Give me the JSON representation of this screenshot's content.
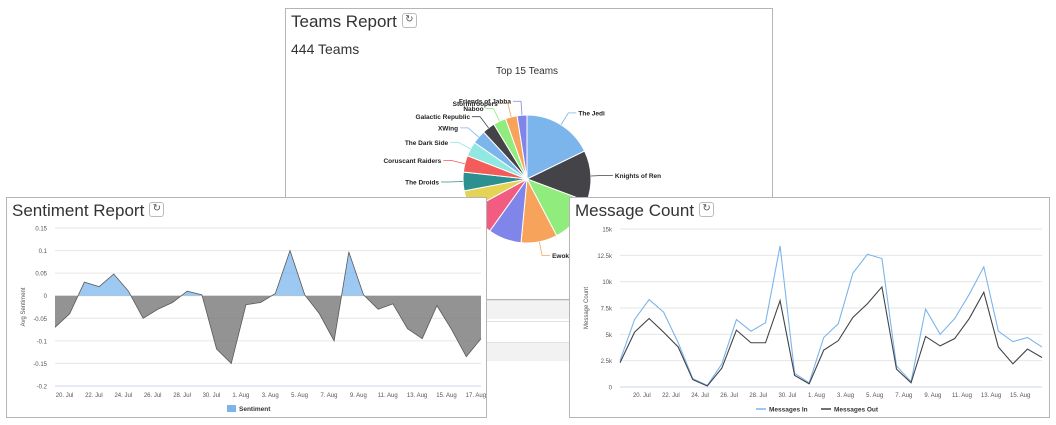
{
  "teams_panel": {
    "title": "Teams Report",
    "refresh_icon": "refresh-icon",
    "count_text": "444 Teams"
  },
  "sentiment_panel": {
    "title": "Sentiment Report",
    "refresh_icon": "refresh-icon"
  },
  "messages_panel": {
    "title": "Message Count",
    "refresh_icon": "refresh-icon"
  },
  "chart_data": [
    {
      "id": "top-teams",
      "type": "pie",
      "title": "Top 15 Teams",
      "labels": [
        "The Jedi",
        "Knights of Ren",
        "",
        "Ewoks",
        "",
        "",
        "",
        "The Droids",
        "Coruscant Raiders",
        "The Dark Side",
        "XWing",
        "Galactic Republic",
        "Naboo",
        "Stormtroopers",
        "Friends of Jabba"
      ],
      "visible_partial_labels": [
        "rs"
      ],
      "values": [
        72,
        52,
        47,
        37,
        34,
        29,
        20,
        19,
        17,
        15,
        14,
        13,
        13,
        12,
        10
      ],
      "colors": [
        "#7cb5ec",
        "#434348",
        "#90ed7d",
        "#f7a35c",
        "#8085e9",
        "#f15c80",
        "#e4d354",
        "#2b908f",
        "#f45b5b",
        "#91e8e1",
        "#7cb5ec",
        "#434348",
        "#90ed7d",
        "#f7a35c",
        "#8085e9"
      ]
    },
    {
      "id": "sentiment",
      "type": "area",
      "title": "Sentiment Report",
      "xlabel": "",
      "ylabel": "Avg Sentiment",
      "ylim": [
        -0.2,
        0.15
      ],
      "yticks": [
        0.15,
        0.1,
        0.05,
        0,
        -0.05,
        -0.1,
        -0.15,
        -0.2
      ],
      "ytick_labels": [
        "0.15",
        "0.1",
        "0.05",
        "0",
        "-0.05",
        "-0.1",
        "-0.15",
        "-0.2"
      ],
      "xticks": [
        2,
        4,
        6,
        8,
        10,
        12,
        14,
        16,
        18,
        20,
        22,
        24,
        26,
        28
      ],
      "xtick_labels": [
        "20. Jul",
        "22. Jul",
        "24. Jul",
        "26. Jul",
        "28. Jul",
        "30. Jul",
        "1. Aug",
        "3. Aug",
        "5. Aug",
        "7. Aug",
        "9. Aug",
        "11. Aug",
        "13. Aug",
        "15. Aug",
        "17. Aug"
      ],
      "x_range": [
        0.8,
        29.4
      ],
      "x": [
        1,
        2,
        3,
        4,
        5,
        6,
        7,
        8,
        9,
        10,
        11,
        12,
        13,
        14,
        15,
        16,
        17,
        18,
        19,
        20,
        21,
        22,
        23,
        24,
        25,
        26,
        27,
        28,
        29
      ],
      "series": [
        {
          "name": "Sentiment",
          "values": [
            -0.07,
            -0.04,
            0.03,
            0.02,
            0.048,
            0.01,
            -0.05,
            -0.03,
            -0.015,
            0.01,
            0.002,
            -0.118,
            -0.15,
            -0.02,
            -0.015,
            0.005,
            0.1,
            0.002,
            -0.04,
            -0.1,
            0.097,
            0.002,
            -0.03,
            -0.018,
            -0.073,
            -0.095,
            -0.022,
            -0.075,
            -0.135,
            -0.095
          ]
        }
      ],
      "pos_color": "#7cb5ec",
      "neg_color": "#808080",
      "legend": "bottom-center"
    },
    {
      "id": "message-count",
      "type": "line",
      "title": "Message Count",
      "xlabel": "",
      "ylabel": "Message Count",
      "ylim": [
        0,
        15000
      ],
      "yticks": [
        0,
        2500,
        5000,
        7500,
        10000,
        12500,
        15000
      ],
      "ytick_labels": [
        "0",
        "2.5k",
        "5k",
        "7.5k",
        "10k",
        "12.5k",
        "15k"
      ],
      "xtick_labels": [
        "20. Jul",
        "22. Jul",
        "24. Jul",
        "26. Jul",
        "28. Jul",
        "30. Jul",
        "1. Aug",
        "3. Aug",
        "5. Aug",
        "7. Aug",
        "9. Aug",
        "11. Aug",
        "13. Aug",
        "15. Aug"
      ],
      "series": [
        {
          "name": "Messages In",
          "color": "#7cb5ec",
          "values": [
            2500,
            6400,
            8300,
            7100,
            4200,
            800,
            150,
            2200,
            6400,
            5300,
            6100,
            13400,
            1300,
            400,
            4700,
            6000,
            10800,
            12600,
            12200,
            2000,
            500,
            7400,
            5000,
            6500,
            8800,
            11400,
            5300,
            4300,
            4700,
            3800
          ]
        },
        {
          "name": "Messages Out",
          "color": "#434348",
          "values": [
            2300,
            5200,
            6500,
            5200,
            3800,
            700,
            100,
            1800,
            5400,
            4200,
            4200,
            8200,
            1100,
            300,
            3500,
            4400,
            6600,
            7900,
            9500,
            1700,
            400,
            4800,
            3900,
            4600,
            6500,
            9000,
            3800,
            2200,
            3600,
            2800
          ]
        }
      ],
      "legend": "bottom-center"
    }
  ]
}
